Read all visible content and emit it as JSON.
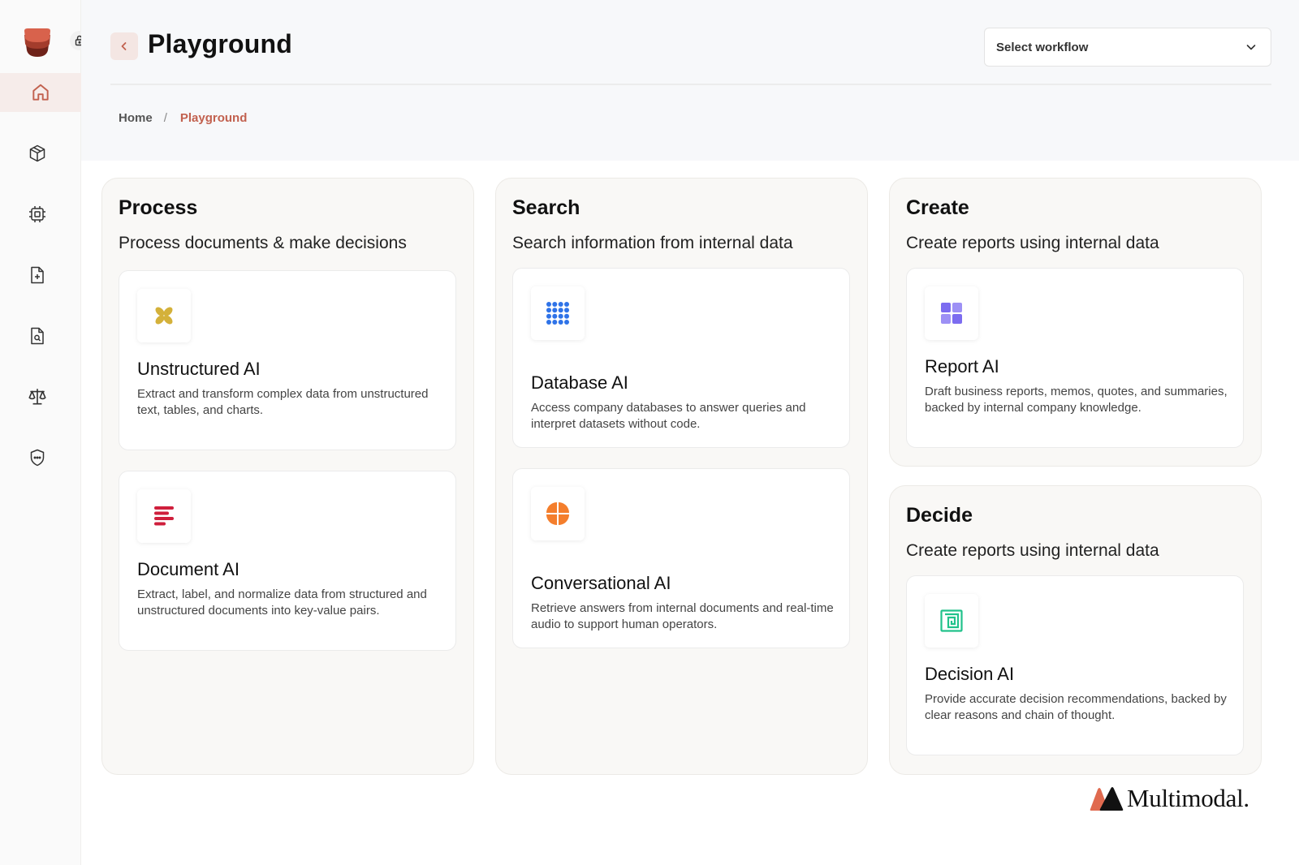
{
  "header": {
    "title": "Playground",
    "workflow_select": {
      "value": "Select workflow"
    }
  },
  "breadcrumb": {
    "home": "Home",
    "separator": "/",
    "current": "Playground"
  },
  "sidebar": {
    "items": [
      {
        "icon": "home-icon",
        "active": true
      },
      {
        "icon": "cube-icon"
      },
      {
        "icon": "chip-icon"
      },
      {
        "icon": "file-plus-icon"
      },
      {
        "icon": "file-search-icon"
      },
      {
        "icon": "scale-icon"
      },
      {
        "icon": "shield-icon"
      }
    ]
  },
  "panels": {
    "process": {
      "title": "Process",
      "subtitle": "Process documents & make decisions",
      "cards": [
        {
          "title": "Unstructured AI",
          "description": "Extract and transform complex data from unstructured text, tables, and charts.",
          "icon": "clover-icon",
          "color": "#d4b13a"
        },
        {
          "title": "Document AI",
          "description": "Extract, label, and normalize data from structured and unstructured documents into key-value pairs.",
          "icon": "lines-icon",
          "color": "#cf1f3c"
        }
      ]
    },
    "search": {
      "title": "Search",
      "subtitle": "Search information from internal data",
      "cards": [
        {
          "title": "Database AI",
          "description": "Access company databases to answer queries and interpret datasets without code.",
          "icon": "dot-grid-icon",
          "color": "#2f73e8"
        },
        {
          "title": "Conversational AI",
          "description": "Retrieve answers from internal documents and real-time audio to support human operators.",
          "icon": "quarter-circle-icon",
          "color": "#f47e2c"
        }
      ]
    },
    "create": {
      "title": "Create",
      "subtitle": "Create reports using internal data",
      "cards": [
        {
          "title": "Report AI",
          "description": "Draft business reports, memos, quotes, and summaries, backed by internal company knowledge.",
          "icon": "squares-icon",
          "color": "#7c6cf0"
        }
      ]
    },
    "decide": {
      "title": "Decide",
      "subtitle": "Create reports using internal data",
      "cards": [
        {
          "title": "Decision AI",
          "description": "Provide accurate decision recommendations, backed by clear reasons and chain of thought.",
          "icon": "spiral-square-icon",
          "color": "#21c28b"
        }
      ]
    }
  },
  "brand": {
    "name": "Multimodal."
  },
  "colors": {
    "accent": "#c2614f",
    "active_nav_bg": "#f6ecea"
  }
}
